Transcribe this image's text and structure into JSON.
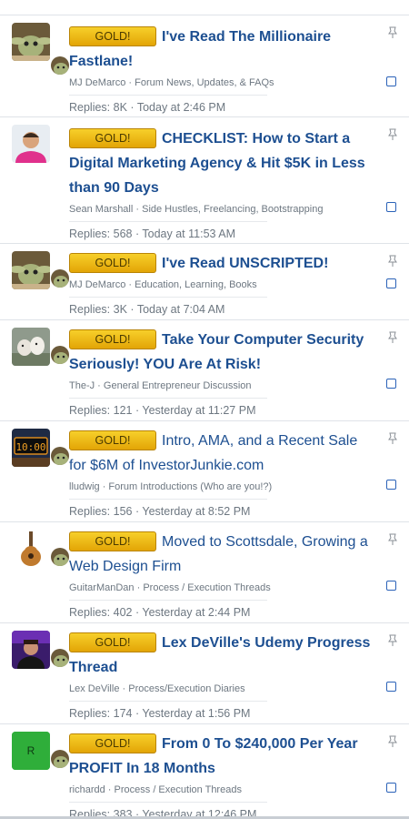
{
  "prefix_label": "GOLD!",
  "threads": [
    {
      "title_lines": [
        "I've Read The Millionaire",
        "Fastlane!"
      ],
      "author": "MJ DeMarco",
      "forum": "Forum News, Updates, & FAQs",
      "replies_label": "Replies:",
      "replies": "8K",
      "time": "Today at 2:46 PM",
      "avatar": "yoda-avatar"
    },
    {
      "title_lines": [
        "CHECKLIST: How to Start a",
        "Digital Marketing Agency & Hit $5K in Less",
        "than 90 Days"
      ],
      "author": "Sean Marshall",
      "forum": "Side Hustles, Freelancing, Bootstrapping",
      "replies_label": "Replies:",
      "replies": "568",
      "time": "Today at 11:53 AM",
      "avatar": "man-pink-shirt-avatar"
    },
    {
      "title_lines": [
        "I've Read UNSCRIPTED!"
      ],
      "author": "MJ DeMarco",
      "forum": "Education, Learning, Books",
      "replies_label": "Replies:",
      "replies": "3K",
      "time": "Today at 7:04 AM",
      "avatar": "yoda-avatar"
    },
    {
      "title_lines": [
        "Take Your Computer Security",
        "Seriously! YOU Are At Risk!"
      ],
      "author": "The-J",
      "forum": "General Entrepreneur Discussion",
      "replies_label": "Replies:",
      "replies": "121",
      "time": "Yesterday at 11:27 PM",
      "avatar": "dogs-avatar"
    },
    {
      "title_lines": [
        "Intro, AMA, and a Recent Sale",
        "for $6M of InvestorJunkie.com"
      ],
      "author": "lludwig",
      "forum": "Forum Introductions (Who are you!?)",
      "replies_label": "Replies:",
      "replies": "156",
      "time": "Yesterday at 8:52 PM",
      "avatar": "clock-avatar"
    },
    {
      "title_lines": [
        "Moved to Scottsdale, Growing a",
        "Web Design Firm"
      ],
      "author": "GuitarManDan",
      "forum": "Process / Execution Threads",
      "replies_label": "Replies:",
      "replies": "402",
      "time": "Yesterday at 2:44 PM",
      "avatar": "guitar-avatar"
    },
    {
      "title_lines": [
        "Lex DeVille's Udemy Progress",
        "Thread"
      ],
      "author": "Lex DeVille",
      "forum": "Process/Execution Diaries",
      "replies_label": "Replies:",
      "replies": "174",
      "time": "Yesterday at 1:56 PM",
      "avatar": "purple-man-avatar"
    },
    {
      "title_lines": [
        "From 0 To $240,000 Per Year",
        "PROFIT In 18 Months"
      ],
      "author": "richardd",
      "forum": "Process / Execution Threads",
      "replies_label": "Replies:",
      "replies": "383",
      "time": "Yesterday at 12:46 PM",
      "avatar": "letter-r-avatar",
      "avatar_letter": "R"
    }
  ]
}
